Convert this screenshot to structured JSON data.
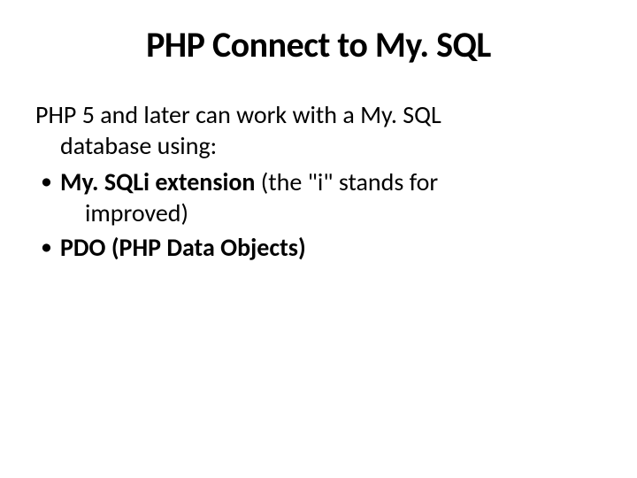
{
  "title": "PHP Connect to My. SQL",
  "intro_line1": "PHP 5 and later can work with a My. SQL",
  "intro_line2": "database using:",
  "bullets": [
    {
      "bold": "My. SQLi extension",
      "rest": " (the \"i\" stands for",
      "cont": "improved)"
    },
    {
      "bold": "PDO (PHP Data Objects)",
      "rest": "",
      "cont": ""
    }
  ]
}
